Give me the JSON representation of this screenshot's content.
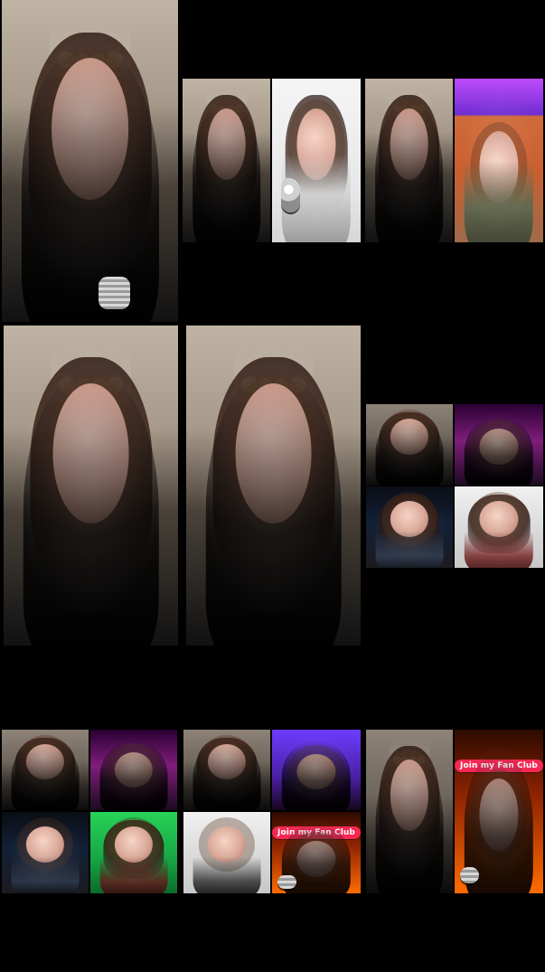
{
  "screen": {
    "title": "",
    "background_color": "#000000"
  },
  "overlays": {
    "join_fan_club_1": "Join my Fan Club",
    "join_fan_club_2": "Join my Fan Club"
  }
}
